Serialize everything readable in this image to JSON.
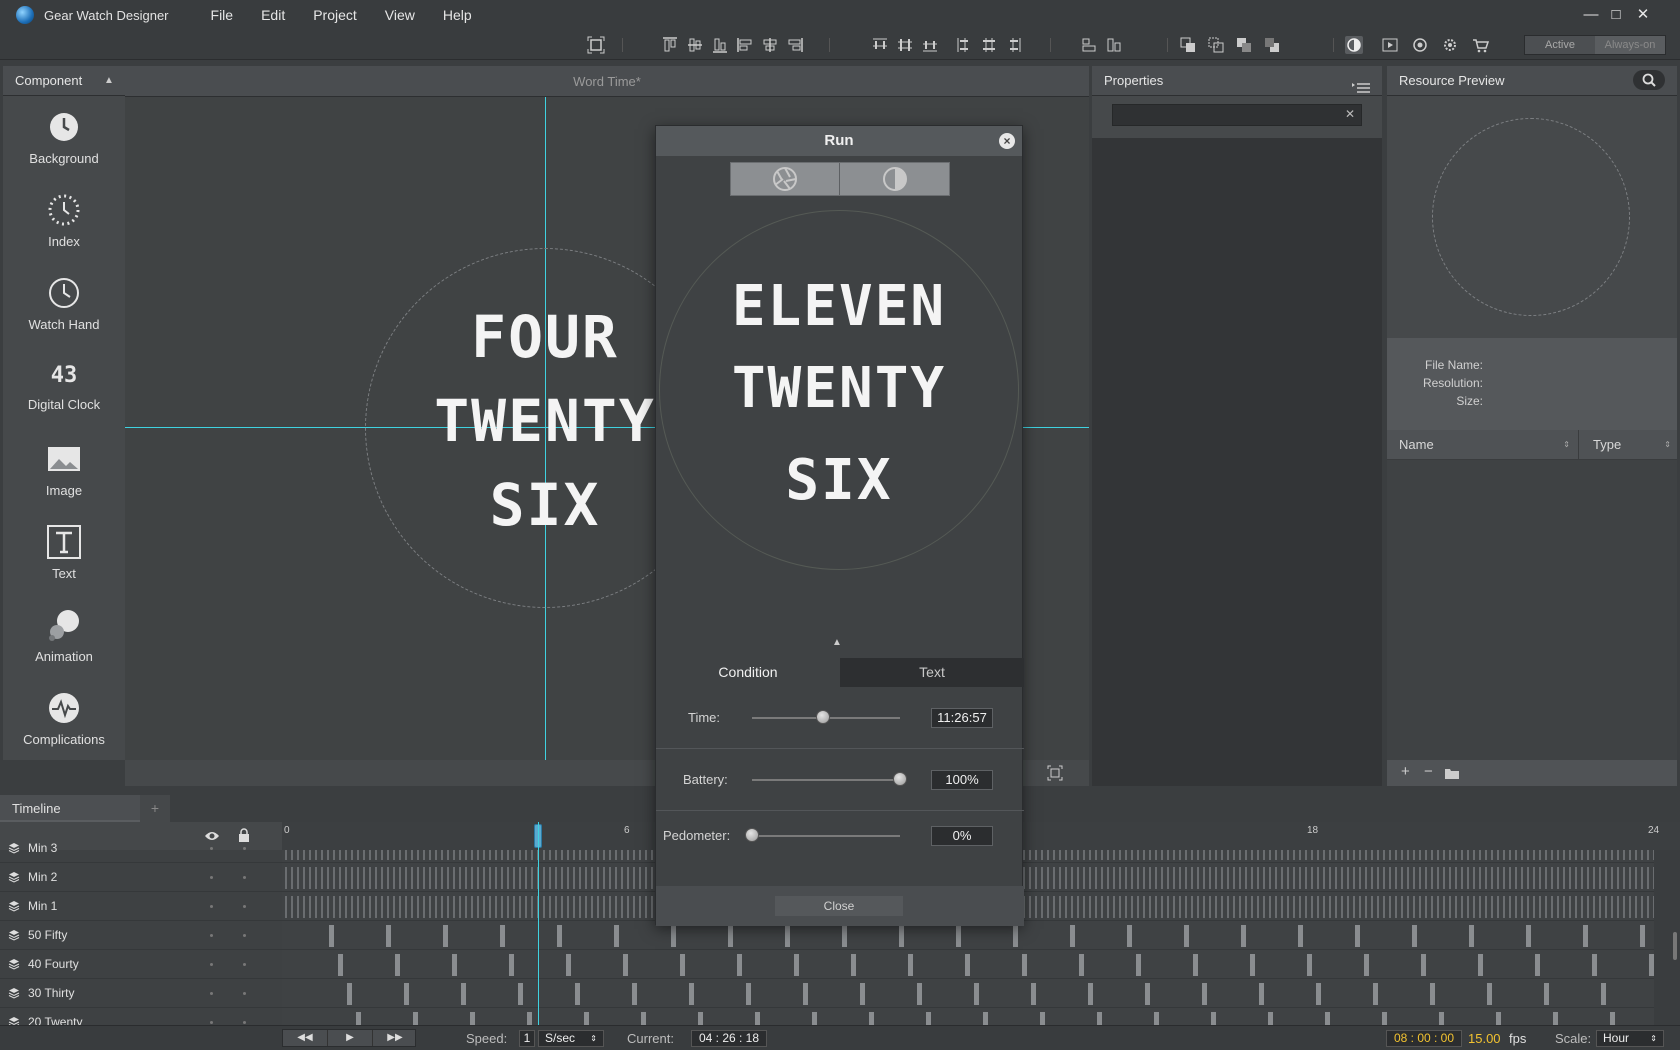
{
  "app": {
    "title": "Gear Watch Designer"
  },
  "menu": [
    "File",
    "Edit",
    "Project",
    "View",
    "Help"
  ],
  "window_controls": {
    "minimize": "—",
    "maximize": "□",
    "close": "✕"
  },
  "mode_switch": {
    "active": "Active",
    "always_on": "Always-on"
  },
  "component_panel": {
    "title": "Component",
    "items": [
      "Background",
      "Index",
      "Watch Hand",
      "Digital Clock",
      "Image",
      "Text",
      "Animation",
      "Complications"
    ]
  },
  "canvas": {
    "tab_title": "Word Time*",
    "watch_lines": [
      "FOUR",
      "TWENTY",
      "SIX"
    ]
  },
  "properties": {
    "title": "Properties",
    "search_value": ""
  },
  "resource_preview": {
    "title": "Resource Preview",
    "info": {
      "file_name": "File Name:",
      "resolution": "Resolution:",
      "size": "Size:"
    },
    "columns": [
      "Name",
      "Type"
    ]
  },
  "run_dialog": {
    "title": "Run",
    "preview_lines": [
      "ELEVEN",
      "TWENTY",
      "SIX"
    ],
    "tabs": [
      "Condition",
      "Text"
    ],
    "time_label": "Time:",
    "time_value": "11:26:57",
    "time_fraction": 0.48,
    "battery_label": "Battery:",
    "battery_value": "100%",
    "battery_fraction": 1.0,
    "pedometer_label": "Pedometer:",
    "pedometer_value": "0%",
    "pedometer_fraction": 0.0,
    "close_label": "Close"
  },
  "timeline": {
    "tab": "Timeline",
    "add": "+",
    "ruler": [
      "0",
      "6",
      "18",
      "24"
    ],
    "layers": [
      "Min 3",
      "Min 2",
      "Min 1",
      "50 Fifty",
      "40 Fourty",
      "30 Thirty",
      "20 Twenty"
    ]
  },
  "status": {
    "speed_label": "Speed:",
    "speed_value": "1",
    "speed_unit": "S/sec",
    "current_label": "Current:",
    "current_value": "04 : 26 : 18",
    "time_value": "08 : 00 : 00",
    "fps_value": "15.00",
    "fps_label": "fps",
    "scale_label": "Scale:",
    "scale_value": "Hour"
  },
  "colors": {
    "guide": "#3fd2e0",
    "highlight": "#f2c230",
    "panel": "#46494b"
  }
}
